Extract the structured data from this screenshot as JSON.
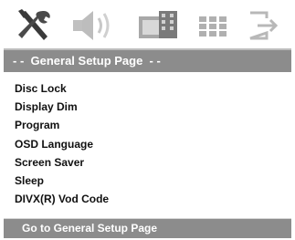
{
  "icons": [
    "tools-icon",
    "speaker-icon",
    "video-icon",
    "grid-icon",
    "exit-icon"
  ],
  "header": {
    "title": "- -  General Setup Page  - -"
  },
  "items": [
    {
      "label": "Disc Lock"
    },
    {
      "label": "Display Dim"
    },
    {
      "label": "Program"
    },
    {
      "label": "OSD Language"
    },
    {
      "label": "Screen Saver"
    },
    {
      "label": "Sleep"
    },
    {
      "label": "DIVX(R) Vod Code"
    }
  ],
  "footer": {
    "text": "Go to General Setup Page"
  },
  "colors": {
    "bar": "#8c8c8c",
    "panel": "#d6d6d6",
    "text_light": "#ffffff",
    "text_dark": "#111111"
  }
}
